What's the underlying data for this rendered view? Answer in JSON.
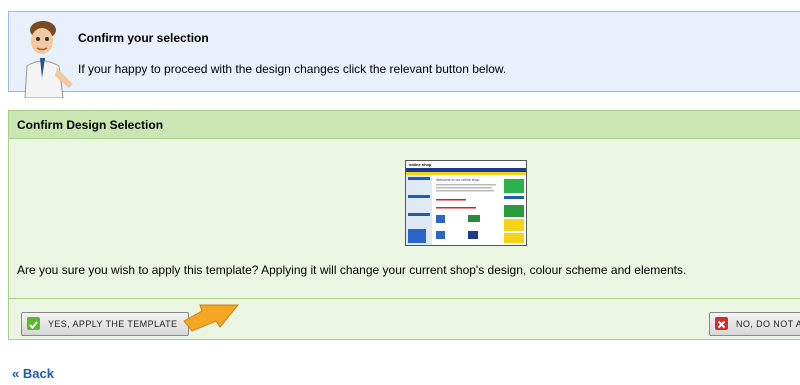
{
  "header": {
    "title": "Confirm your selection",
    "subtitle": "If your happy to proceed with the design changes click the relevant button below."
  },
  "panel": {
    "title": "Confirm Design Selection",
    "preview": {
      "shop_name": "online shop",
      "welcome": "Welcome to our online shop"
    },
    "question": "Are you sure you wish to apply this template? Applying it will change your current shop's design, colour scheme and elements.",
    "yes_label": "YES, APPLY THE TEMPLATE",
    "no_label": "NO, DO NOT A"
  },
  "back_label": "« Back",
  "colors": {
    "header_bg": "#e8f0fb",
    "panel_bg": "#eaf5e2",
    "panel_head_bg": "#c9e6b3",
    "link": "#1c5ea8",
    "arrow": "#f5a623",
    "yes_icon": "#5cb82e",
    "no_icon": "#d62b2b"
  },
  "icons": {
    "mascot": "cartoon-man-icon",
    "yes": "check-icon",
    "no": "cross-icon",
    "pointer": "arrow-icon"
  }
}
